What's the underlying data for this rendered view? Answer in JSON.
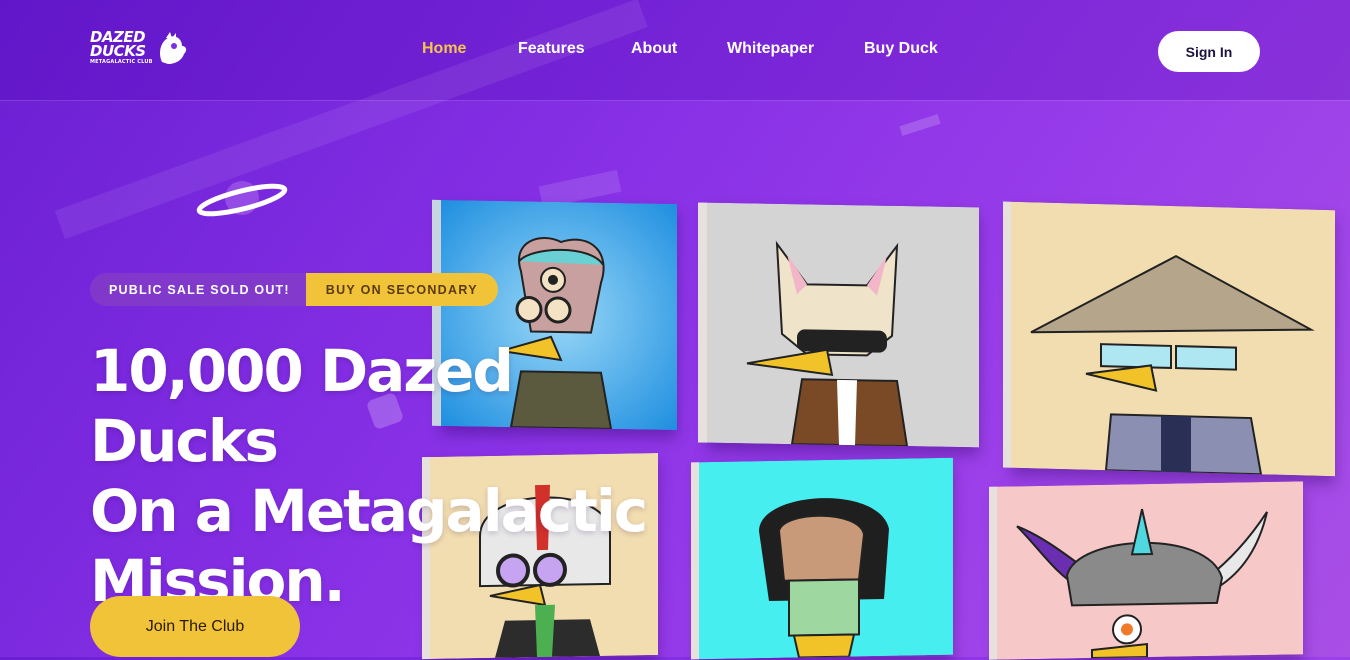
{
  "brand": {
    "logo_line1": "DAZED",
    "logo_line2": "DUCKS",
    "logo_sub": "METAGALACTIC CLUB"
  },
  "nav": {
    "items": [
      {
        "label": "Home",
        "active": true
      },
      {
        "label": "Features",
        "active": false
      },
      {
        "label": "About",
        "active": false
      },
      {
        "label": "Whitepaper",
        "active": false
      },
      {
        "label": "Buy Duck",
        "active": false
      }
    ],
    "signin_label": "Sign In"
  },
  "hero": {
    "sale_status": "PUBLIC SALE SOLD OUT!",
    "secondary_label": "BUY ON SECONDARY",
    "title_line1": "10,000 Dazed Ducks",
    "title_line2": "On a Metagalactic",
    "title_line3": "Mission.",
    "cta_label": "Join The Club"
  },
  "gallery": {
    "cards": [
      {
        "name": "duck-cyclops-brain",
        "bg": "#3aa6e8"
      },
      {
        "name": "duck-cat-hood",
        "bg": "#d2d2d2"
      },
      {
        "name": "duck-straw-hat",
        "bg": "#f2ddb0"
      },
      {
        "name": "duck-helmet",
        "bg": "#f2ddb0"
      },
      {
        "name": "duck-ape",
        "bg": "#43f0f2"
      },
      {
        "name": "duck-horned-helmet",
        "bg": "#f7c6c6"
      }
    ]
  },
  "colors": {
    "accent": "#f1c338",
    "active_nav": "#f4c54a",
    "bg_start": "#6a1fd3",
    "bg_end": "#a94fe6"
  },
  "icons": {
    "planet": "planet-icon",
    "logo": "duck-logo-icon"
  }
}
